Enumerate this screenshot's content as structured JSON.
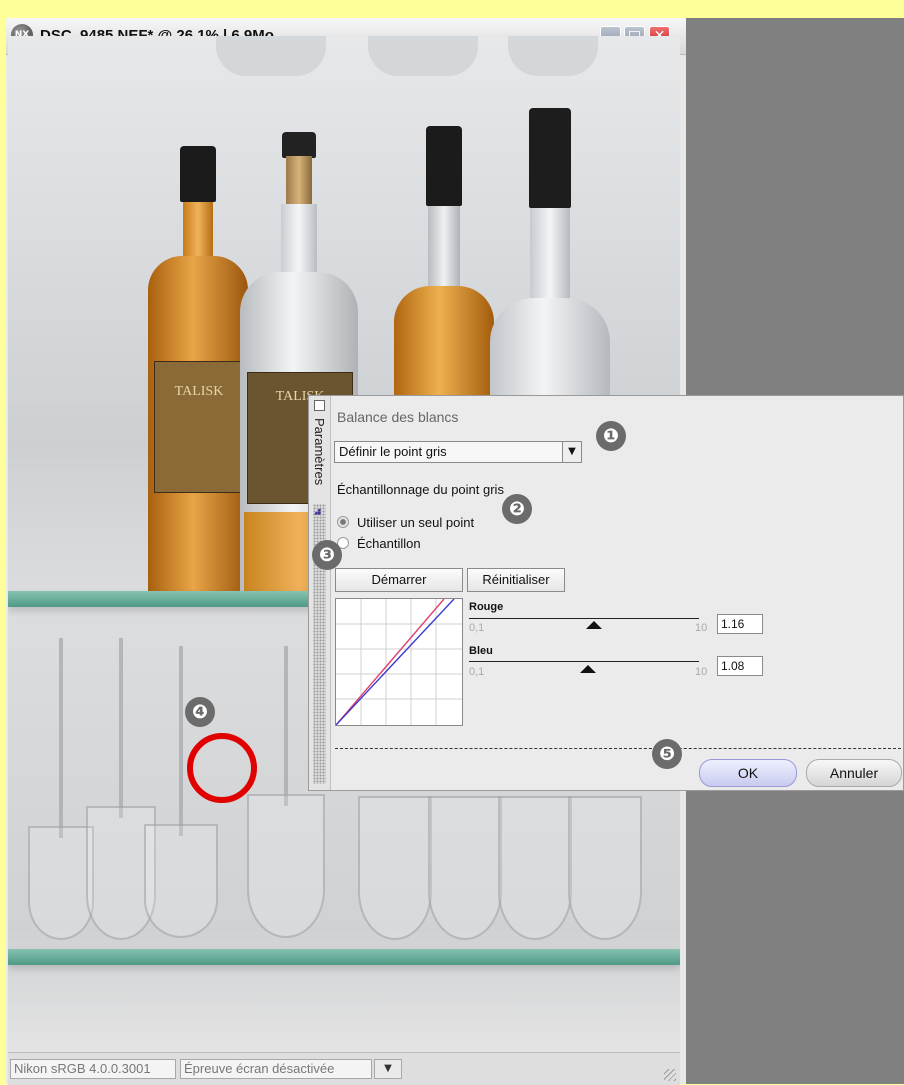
{
  "window": {
    "title": "DSC_9485.NEF* @ 26,1% | 6,9Mo",
    "logo_text": "NX",
    "controls": {
      "minimize": "_",
      "maximize": "□",
      "close": "✕"
    }
  },
  "photo": {
    "bottle_labels": [
      "TALISK",
      "TALISK"
    ]
  },
  "panel": {
    "side_tab": "Paramètres",
    "title": "Balance des blancs",
    "mode_select": {
      "value": "Définir le point gris",
      "arrow": "▼"
    },
    "sampling_label": "Échantillonnage du point gris",
    "radio_options": [
      {
        "label": "Utiliser un seul point",
        "checked": true
      },
      {
        "label": "Échantillon",
        "checked": false
      }
    ],
    "start_button": "Démarrer",
    "reset_button": "Réinitialiser",
    "sliders": [
      {
        "name": "Rouge",
        "min": "0,1",
        "max": "10",
        "value": "1.16"
      },
      {
        "name": "Bleu",
        "min": "0,1",
        "max": "10",
        "value": "1.08"
      }
    ],
    "ok_button": "OK",
    "cancel_button": "Annuler"
  },
  "annotations": {
    "markers": [
      "❶",
      "❷",
      "❸",
      "❹",
      "❺"
    ]
  },
  "statusbar": {
    "color_profile": "Nikon sRGB 4.0.0.3001",
    "soft_proof": "Épreuve écran désactivée",
    "dropdown_arrow": "▼"
  },
  "colors": {
    "desktop_highlight": "#ffff99",
    "workspace_gray": "#808080",
    "shelf_green": "#6fb3a0",
    "annotation_gray": "#6b6b6b",
    "annotation_ring": "#e00000",
    "ok_button": "#c9cbf0",
    "curve_red": "#e0406a",
    "curve_blue": "#3b3bd0"
  }
}
